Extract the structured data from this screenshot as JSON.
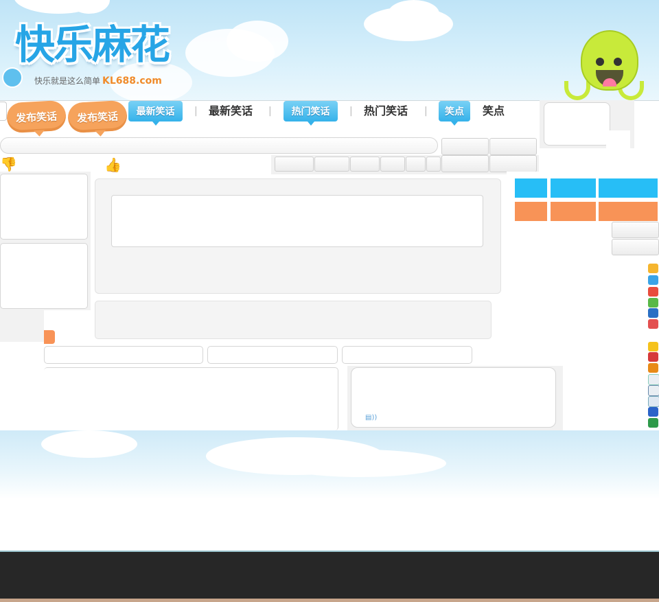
{
  "header": {
    "logo_text": "快乐麻花",
    "tagline": "快乐就是这么简单",
    "site": "KL688.com"
  },
  "nav": {
    "publish_1": "发布笑话",
    "publish_2": "发布笑话",
    "latest_active": "最新笑话",
    "latest": "最新笑话",
    "hot_active": "热门笑话",
    "hot": "热门笑话",
    "points_active": "笑点",
    "points": "笑点",
    "separator": "|"
  },
  "icons": {
    "thumb_down": "thumbs-down-icon",
    "thumb_up": "thumbs-up-icon",
    "share_list": [
      "qzone-icon",
      "pengyou-icon",
      "weibo-icon",
      "kaixin-icon",
      "renren-icon",
      "tqq-icon",
      "favorite-icon",
      "douban-info-icon",
      "tianya-icon",
      "sohu-icon",
      "qq-icon",
      "copy-icon",
      "baidu-icon",
      "douban-icon"
    ]
  },
  "colors": {
    "accent_blue": "#27bef6",
    "accent_orange": "#f89357",
    "footer": "#272727"
  }
}
